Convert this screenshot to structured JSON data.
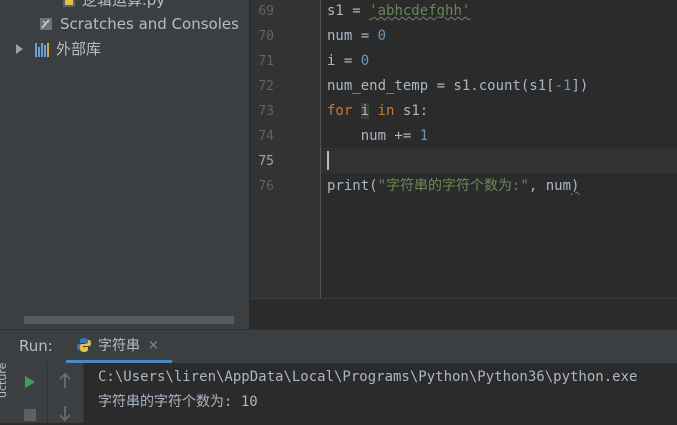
{
  "project": {
    "file_label": "逻辑运算.py",
    "scratches_label": "Scratches and Consoles",
    "external_libs_label": "外部库"
  },
  "editor": {
    "line_numbers": [
      "69",
      "70",
      "71",
      "72",
      "73",
      "74",
      "75",
      "76"
    ],
    "current_line": "75",
    "lines": {
      "l69_var": "s1 = ",
      "l69_str": "'abhcdefghh'",
      "l70": "num = ",
      "l70_num": "0",
      "l71": "i = ",
      "l71_num": "0",
      "l72a": "num_end_temp = s1.count(s1[",
      "l72_num": "-1",
      "l72b": "])",
      "l73_kw1": "for",
      "l73_i": "i",
      "l73_kw2": "in",
      "l73_rest": " s1:",
      "l74a": "    num += ",
      "l74_num": "1",
      "l76a": "print(",
      "l76_str": "\"字符串的字符个数为:\"",
      "l76b": ", num",
      "l76c": ")"
    }
  },
  "run": {
    "label": "Run:",
    "tab_label": "字符串",
    "tab_close": "×",
    "side_label": "ucture"
  },
  "console": {
    "lines": [
      "C:\\Users\\liren\\AppData\\Local\\Programs\\Python\\Python36\\python.exe",
      "字符串的字符个数为: 10"
    ]
  },
  "colors": {
    "keyword": "#cc7832",
    "string": "#6a8759",
    "number": "#6897bb",
    "run_green": "#499c54"
  }
}
